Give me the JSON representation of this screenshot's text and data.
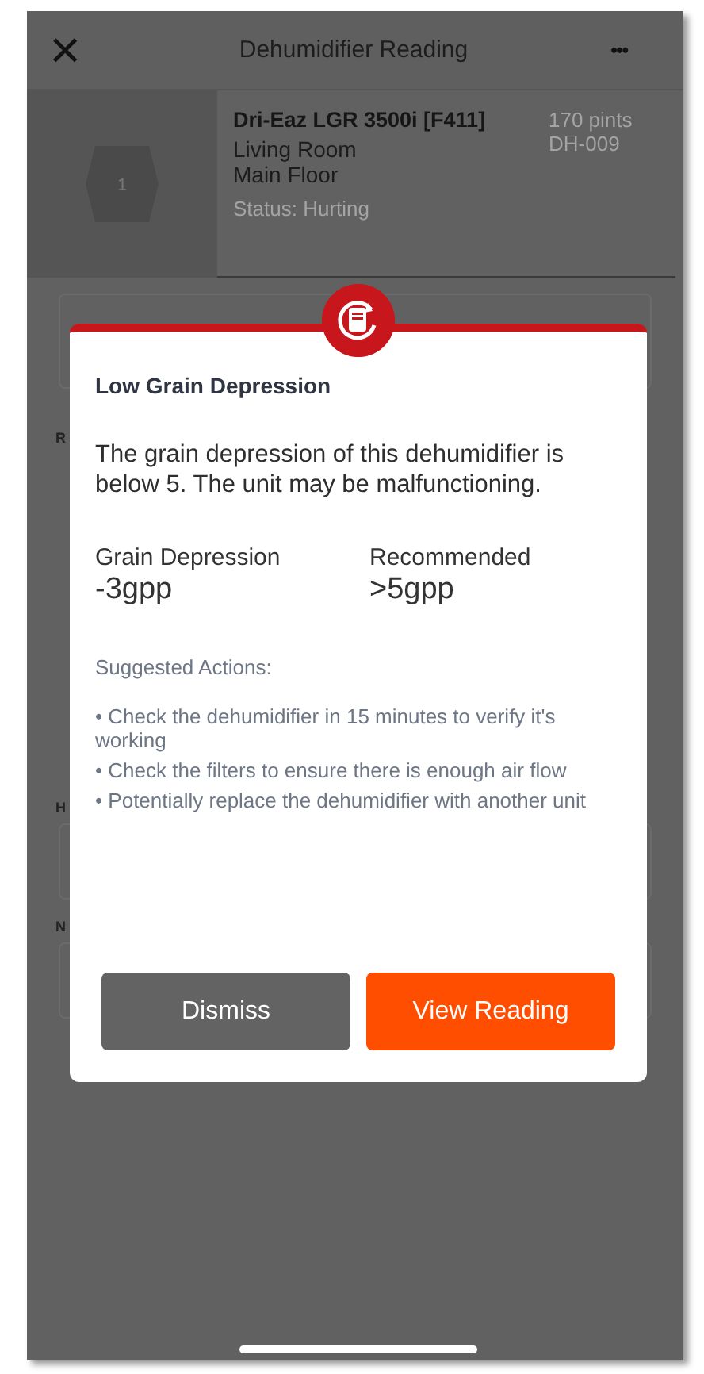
{
  "header": {
    "close_icon": "×",
    "title": "Dehumidifier Reading",
    "more": "•••"
  },
  "device": {
    "badge": "1",
    "name": "Dri-Eaz LGR 3500i [F411]",
    "room": "Living Room",
    "floor": "Main Floor",
    "status": "Status: Hurting",
    "capacity": "170 pints",
    "code": "DH-009"
  },
  "background_labels": [
    "R",
    "H",
    "N"
  ],
  "dialog": {
    "title": "Low Grain Depression",
    "message": "The grain depression of this dehumidifier is below 5. The unit may be malfunctioning.",
    "stats": [
      {
        "label": "Grain Depression",
        "value": "-3gpp"
      },
      {
        "label": "Recommended",
        "value": ">5gpp"
      }
    ],
    "actions_heading": "Suggested Actions:",
    "actions": [
      "• Check the dehumidifier in 15 minutes to verify it's working",
      "• Check the filters to ensure there is enough air flow",
      "• Potentially replace the dehumidifier with another unit"
    ],
    "buttons": [
      {
        "label": "Dismiss",
        "kind": "secondary"
      },
      {
        "label": "View Reading",
        "kind": "primary"
      }
    ]
  }
}
